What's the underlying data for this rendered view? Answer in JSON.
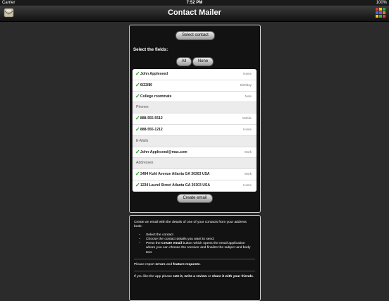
{
  "status": {
    "carrier": "Carrier",
    "time": "7:52 PM",
    "battery": "100%"
  },
  "nav": {
    "title": "Contact Mailer",
    "left_icon": "mail-icon",
    "right_icon": "colorful-grid-icon"
  },
  "selector": {
    "select_label": "Select contact",
    "fields_label": "Select the fields:",
    "all_label": "All",
    "none_label": "None"
  },
  "fields": [
    {
      "type": "item",
      "text": "John Appleseed",
      "label": "Name"
    },
    {
      "type": "item",
      "text": "6/22/80",
      "label": "Birthday"
    },
    {
      "type": "item",
      "text": "College roommate",
      "label": "Note"
    },
    {
      "type": "section",
      "text": "Phones"
    },
    {
      "type": "item",
      "text": "888-555-5512",
      "label": "Mobile"
    },
    {
      "type": "item",
      "text": "888-555-1212",
      "label": "Home"
    },
    {
      "type": "section",
      "text": "E-Mails"
    },
    {
      "type": "item",
      "text": "John-Appleseed@mac.com",
      "label": "Work"
    },
    {
      "type": "section",
      "text": "Addresses"
    },
    {
      "type": "item",
      "text": "3494 Kuhl Avenue Atlanta GA 30303 USA",
      "label": "Work"
    },
    {
      "type": "item",
      "text": "1234 Laurel Street Atlanta GA 30303 USA",
      "label": "Home"
    }
  ],
  "create_label": "Create email",
  "info": {
    "intro": "Create an email with the details of one of your contacts from your address book:",
    "steps": [
      "Select the contact",
      "Choose the contact details you want to send.",
      {
        "pre": "Press the ",
        "bold": "Create email",
        "post": " button which opens the email application where you can choose the receiver and finalize the subject and body text."
      }
    ],
    "report": {
      "pre": "Please report ",
      "b1": "errors",
      "mid": " and ",
      "b2": "feature requests",
      "post": "."
    },
    "like": {
      "pre": "If you like the app please ",
      "b1": "rate it, write a review",
      "mid": " or ",
      "b2": "share it with your friends",
      "post": "."
    }
  },
  "colors": {
    "accent_check": "#1a9b1a",
    "panel_bg": "#121212",
    "page_bg": "#2b2b2b"
  }
}
